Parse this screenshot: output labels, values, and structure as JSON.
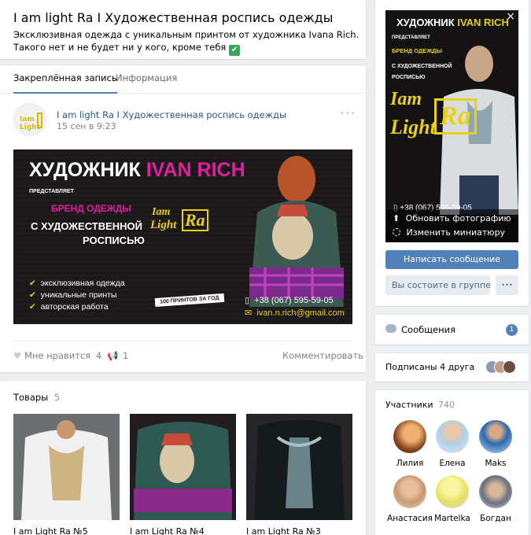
{
  "group": {
    "title": "I am light Ra I Художественная роспись одежды",
    "description": "Эксклюзивная одежда с уникальным принтом от художника Ivana Rich. Такого нет и не будет ни у кого, кроме тебя",
    "check_emoji": "✔"
  },
  "tabs": [
    {
      "label": "Закреплённая запись"
    },
    {
      "label": "Информация"
    }
  ],
  "post": {
    "author": "I am light Ra I Художественная роспись одежды",
    "date": "15 сен в 9:23",
    "more": "•••",
    "banner": {
      "title_white": "ХУДОЖНИК",
      "title_accent": "IVAN RICH",
      "presents": "ПРЕДСТАВЛЯЕТ",
      "brand_line": "БРЕНД ОДЕЖДЫ",
      "line2": "С ХУДОЖЕСТВЕННОЙ",
      "line3": "РОСПИСЬЮ",
      "logo1": "Iam",
      "logo2": "Light",
      "logo3": "Ra",
      "bullets": [
        "эксклюзивная одежда",
        "уникальные принты",
        "авторская работа"
      ],
      "badge": "100 ПРИНТОВ ЗА ГОД",
      "phone": "+38 (067) 595-59-05",
      "email": "ivan.n.rich@gmail.com"
    },
    "likes_label": "Мне нравится",
    "likes_count": "4",
    "shares_count": "1",
    "comment_label": "Комментировать"
  },
  "products": {
    "label": "Товары",
    "count": "5",
    "items": [
      {
        "name": "I am Light Ra №5"
      },
      {
        "name": "I am Light Ra №4"
      },
      {
        "name": "I am Light Ra №3"
      }
    ]
  },
  "cover": {
    "close": "×",
    "title_white": "ХУДОЖНИК",
    "title_accent": "IVAN RICH",
    "presents": "ПРЕДСТАВЛЯЕТ",
    "brand_line": "БРЕНД ОДЕЖДЫ",
    "line2": "С ХУДОЖЕСТВЕННОЙ",
    "line3": "РОСПИСЬЮ",
    "logo1": "Iam",
    "logo2": "Light",
    "logo3": "Ra",
    "phone": "+38 (067) 595-59-05",
    "update_photo": "Обновить фотографию",
    "change_thumb": "Изменить миниатюру"
  },
  "actions": {
    "message_button": "Написать сообщение",
    "member_status": "Вы состоите в группе",
    "more": "•••"
  },
  "messages": {
    "label": "Сообщения",
    "count": "1"
  },
  "friends": {
    "label": "Подписаны 4 друга"
  },
  "members": {
    "label": "Участники",
    "count": "740",
    "people": [
      {
        "name": "Лилия"
      },
      {
        "name": "Елена"
      },
      {
        "name": "Maks"
      },
      {
        "name": "Анастасия"
      },
      {
        "name": "Martelka"
      },
      {
        "name": "Богдан"
      }
    ]
  },
  "colors": {
    "link": "#2a5885",
    "button": "#5181b8",
    "banner_accent": "#e01fa0",
    "logo": "#e8d10f"
  }
}
